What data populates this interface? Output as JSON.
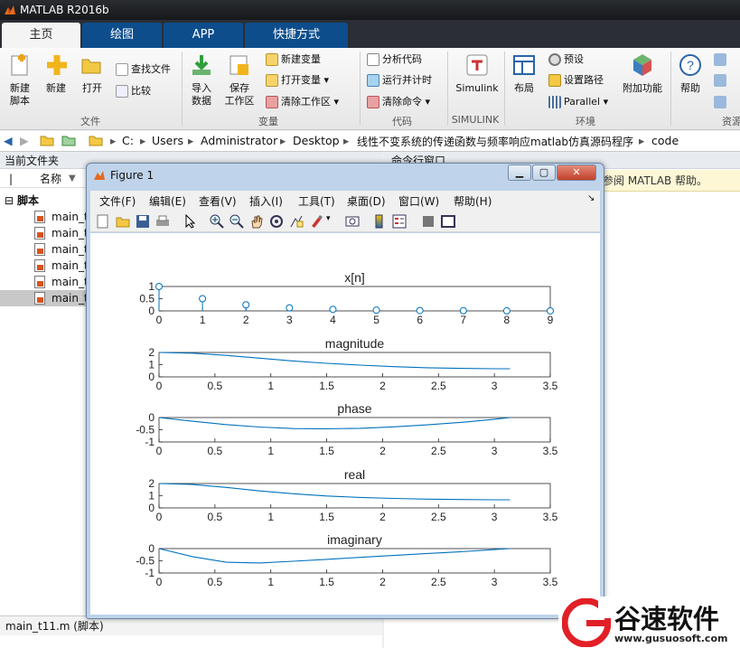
{
  "app": {
    "title": "MATLAB R2016b"
  },
  "tabs": [
    "主页",
    "绘图",
    "APP",
    "快捷方式"
  ],
  "ribbon": {
    "file_group": {
      "new_script": "新建\n脚本",
      "new": "新建",
      "open": "打开",
      "find_files": "查找文件",
      "compare": "比较",
      "label": "文件"
    },
    "variable_group": {
      "import": "导入\n数据",
      "save_ws": "保存\n工作区",
      "new_var": "新建变量",
      "open_var": "打开变量",
      "clear_ws": "清除工作区",
      "label": "变量"
    },
    "code_group": {
      "analyze": "分析代码",
      "run_time": "运行并计时",
      "clear_cmd": "清除命令",
      "label": "代码"
    },
    "simulink_group": {
      "simulink": "Simulink",
      "label": "SIMULINK"
    },
    "env_group": {
      "layout": "布局",
      "prefs": "预设",
      "set_path": "设置路径",
      "parallel": "Parallel",
      "addons": "附加功能",
      "label": "环境"
    },
    "resources_group": {
      "help": "帮助",
      "label": "资源"
    }
  },
  "address": {
    "parts": [
      "C:",
      "Users",
      "Administrator",
      "Desktop",
      "线性不变系统的传递函数与频率响应matlab仿真源码程序",
      "code"
    ]
  },
  "left_panel": {
    "title": "当前文件夹",
    "column": "名称",
    "folder": "脚本",
    "files": [
      "main_t",
      "main_t",
      "main_t",
      "main_t",
      "main_t",
      "main_t"
    ],
    "status": "main_t11.m (脚本)"
  },
  "right_panel": {
    "title": "命令行窗口",
    "notice": "请参阅 MATLAB 帮助。"
  },
  "figure": {
    "title": "Figure 1",
    "menu": [
      "文件(F)",
      "编辑(E)",
      "查看(V)",
      "插入(I)",
      "工具(T)",
      "桌面(D)",
      "窗口(W)",
      "帮助(H)"
    ]
  },
  "chart_data": [
    {
      "type": "stem",
      "title": "x[n]",
      "x": [
        0,
        1,
        2,
        3,
        4,
        5,
        6,
        7,
        8,
        9
      ],
      "values": [
        1,
        0.5,
        0.25,
        0.125,
        0.0625,
        0.03125,
        0.015625,
        0.0078125,
        0.0039,
        0.002
      ],
      "ylim": [
        0,
        1
      ],
      "yticks": [
        "0",
        "0.5",
        "1"
      ],
      "xticks": [
        "0",
        "1",
        "2",
        "3",
        "4",
        "5",
        "6",
        "7",
        "8",
        "9"
      ]
    },
    {
      "type": "line",
      "title": "magnitude",
      "ylim": [
        0,
        2
      ],
      "yticks": [
        "0",
        "1",
        "2"
      ],
      "xlim": [
        0,
        3.5
      ],
      "xticks": [
        "0",
        "0.5",
        "1",
        "1.5",
        "2",
        "2.5",
        "3",
        "3.5"
      ],
      "x": [
        0,
        0.3,
        0.6,
        0.9,
        1.2,
        1.5,
        1.8,
        2.1,
        2.4,
        2.7,
        3.0,
        3.14
      ],
      "values": [
        2.0,
        1.94,
        1.76,
        1.53,
        1.3,
        1.11,
        0.96,
        0.84,
        0.75,
        0.7,
        0.67,
        0.67
      ]
    },
    {
      "type": "line",
      "title": "phase",
      "ylim": [
        -1,
        0
      ],
      "yticks": [
        "-1",
        "-0.5",
        "0"
      ],
      "xlim": [
        0,
        3.5
      ],
      "xticks": [
        "0",
        "0.5",
        "1",
        "1.5",
        "2",
        "2.5",
        "3",
        "3.5"
      ],
      "x": [
        0,
        0.3,
        0.6,
        0.9,
        1.2,
        1.5,
        1.8,
        2.1,
        2.4,
        2.7,
        3.0,
        3.14
      ],
      "values": [
        0,
        -0.15,
        -0.29,
        -0.39,
        -0.45,
        -0.46,
        -0.44,
        -0.38,
        -0.3,
        -0.2,
        -0.07,
        0
      ]
    },
    {
      "type": "line",
      "title": "real",
      "ylim": [
        0,
        2
      ],
      "yticks": [
        "0",
        "1",
        "2"
      ],
      "xlim": [
        0,
        3.5
      ],
      "xticks": [
        "0",
        "0.5",
        "1",
        "1.5",
        "2",
        "2.5",
        "3",
        "3.5"
      ],
      "x": [
        0,
        0.3,
        0.6,
        0.9,
        1.2,
        1.5,
        1.8,
        2.1,
        2.4,
        2.7,
        3.0,
        3.14
      ],
      "values": [
        2.0,
        1.92,
        1.68,
        1.39,
        1.16,
        0.98,
        0.86,
        0.78,
        0.72,
        0.69,
        0.67,
        0.67
      ]
    },
    {
      "type": "line",
      "title": "imaginary",
      "ylim": [
        -1,
        0
      ],
      "yticks": [
        "-1",
        "-0.5",
        "0"
      ],
      "xlim": [
        0,
        3.5
      ],
      "xticks": [
        "0",
        "0.5",
        "1",
        "1.5",
        "2",
        "2.5",
        "3",
        "3.5"
      ],
      "x": [
        0,
        0.3,
        0.6,
        0.9,
        1.2,
        1.5,
        1.8,
        2.1,
        2.4,
        2.7,
        3.0,
        3.14
      ],
      "values": [
        0,
        -0.33,
        -0.56,
        -0.59,
        -0.52,
        -0.44,
        -0.36,
        -0.28,
        -0.2,
        -0.13,
        -0.04,
        0
      ]
    }
  ],
  "watermark": {
    "name": "谷速软件",
    "url": "www.gusuosoft.com"
  },
  "colors": {
    "plot_line": "#0072bd",
    "titlebar": "#1b1d20",
    "tab_blue": "#0d4d8c"
  }
}
